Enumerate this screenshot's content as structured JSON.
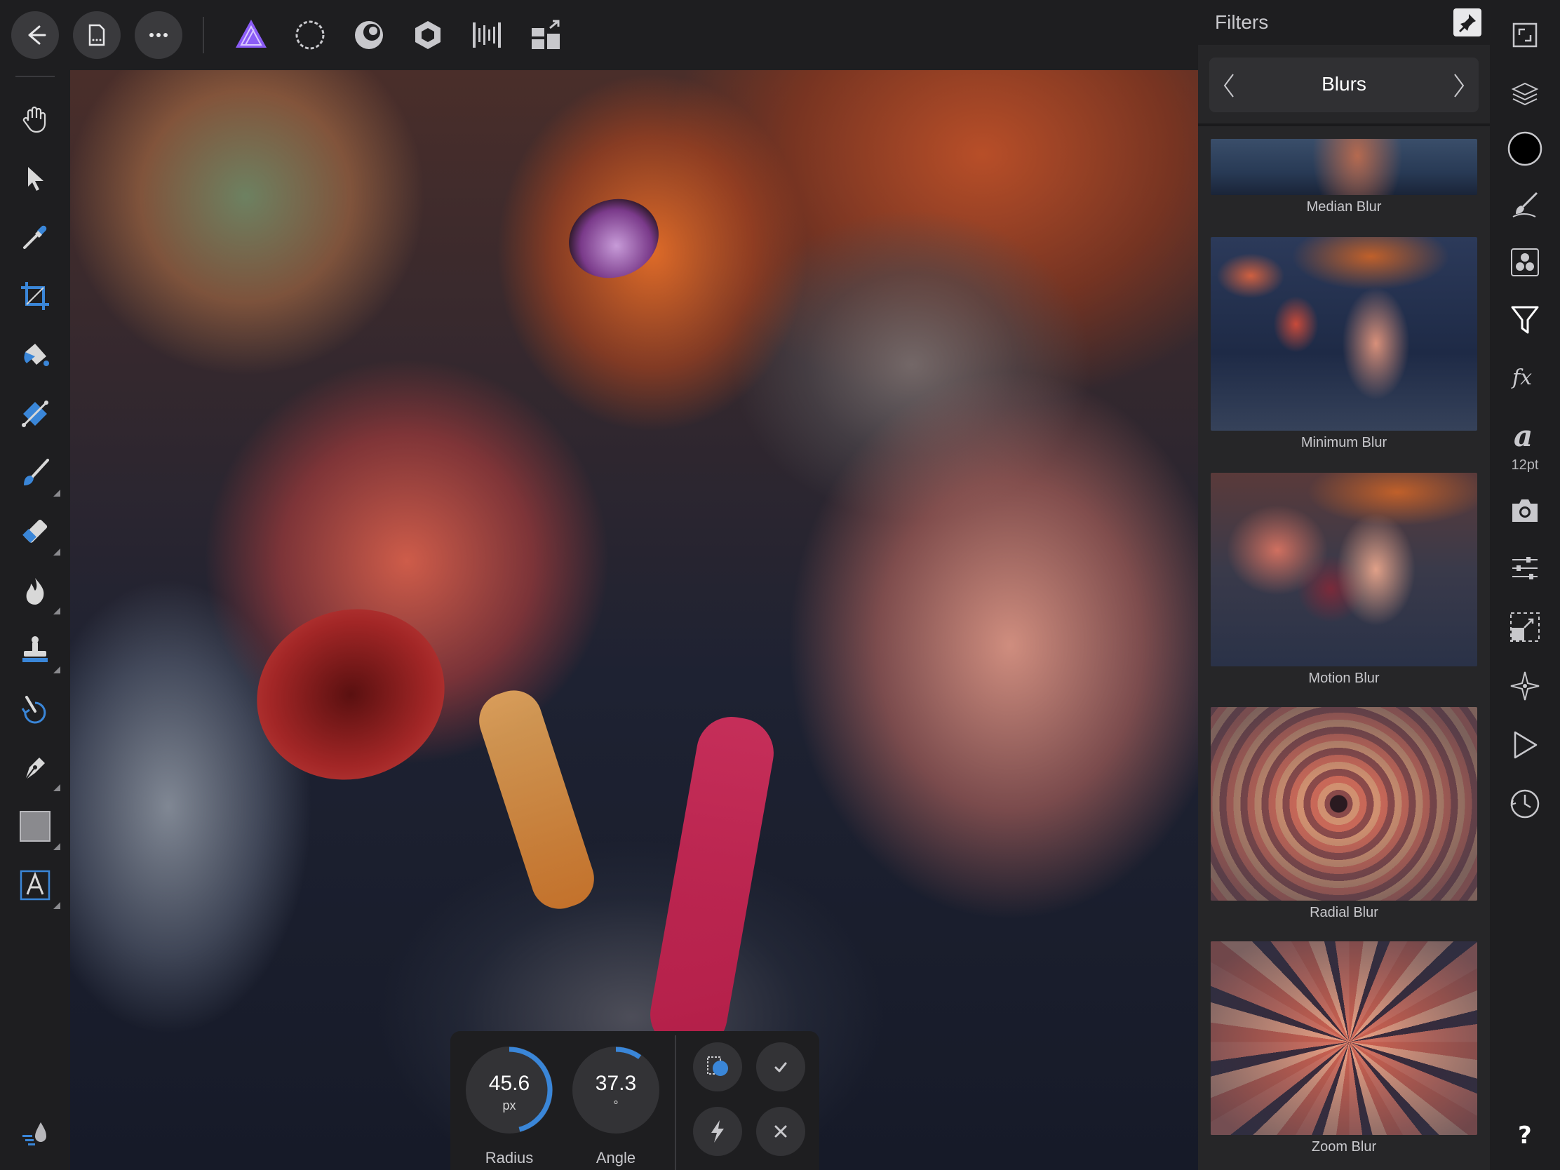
{
  "top_toolbar": {
    "buttons": [
      {
        "name": "back",
        "icon": "arrow-left-icon"
      },
      {
        "name": "document",
        "icon": "document-icon"
      },
      {
        "name": "more",
        "icon": "ellipsis-icon"
      }
    ],
    "personas": [
      {
        "name": "photo",
        "icon": "photo-persona-icon",
        "active": true
      },
      {
        "name": "liquify",
        "icon": "liquify-persona-icon"
      },
      {
        "name": "develop",
        "icon": "develop-persona-icon"
      },
      {
        "name": "tone-mapping",
        "icon": "tone-mapping-persona-icon"
      },
      {
        "name": "selection",
        "icon": "selection-persona-icon"
      },
      {
        "name": "export",
        "icon": "export-persona-icon"
      }
    ],
    "accent_color": "#8b5cf6"
  },
  "left_tools": [
    "hand-icon",
    "move-icon",
    "color-picker-icon",
    "crop-icon",
    "flood-fill-icon",
    "gradient-icon",
    "paint-brush-icon",
    "eraser-icon",
    "burn-icon",
    "clone-icon",
    "undo-brush-icon",
    "pen-icon",
    "rectangle-icon",
    "text-icon"
  ],
  "filters_panel": {
    "title": "Filters",
    "category": "Blurs",
    "filters": [
      {
        "label": "Median Blur"
      },
      {
        "label": "Minimum Blur"
      },
      {
        "label": "Motion Blur"
      },
      {
        "label": "Radial Blur"
      },
      {
        "label": "Zoom Blur"
      }
    ]
  },
  "right_studios": {
    "font_size": "12pt",
    "primary_color": "#000000"
  },
  "context_toolbar": {
    "radius": {
      "value": "45.6",
      "unit": "px",
      "label": "Radius",
      "fraction": 0.46
    },
    "angle": {
      "value": "37.3",
      "unit": "°",
      "label": "Angle",
      "fraction": 0.1
    },
    "dial_color": "#3a86d8"
  }
}
